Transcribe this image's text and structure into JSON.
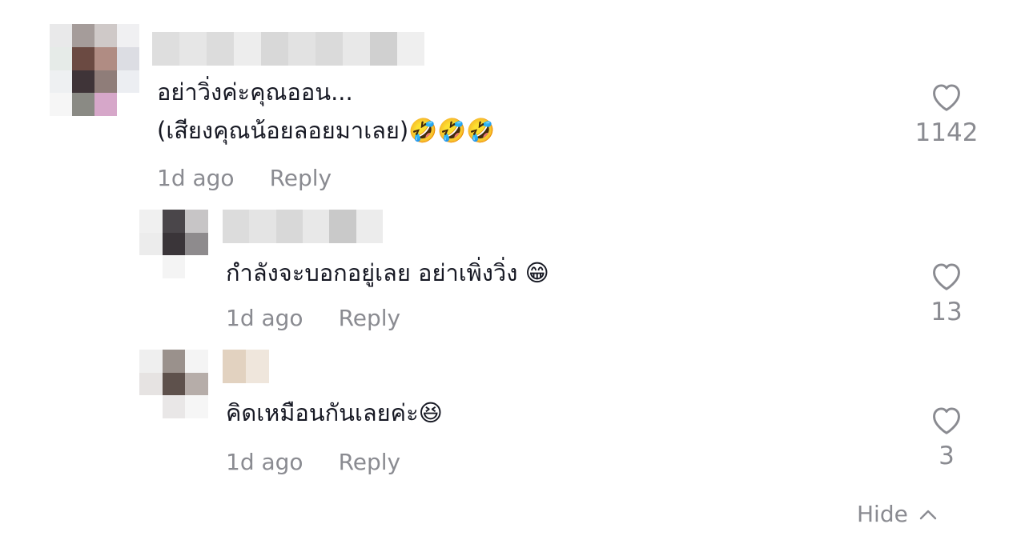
{
  "comments": [
    {
      "text_line1": "อย่าวิ่งค่ะคุณออน...",
      "text_line2": "(เสียงคุณน้อยลอยมาเลย)🤣🤣🤣",
      "time": "1d ago",
      "reply": "Reply",
      "likes": "1142",
      "icon": "heart-outline-icon"
    },
    {
      "text_line1": "กำลังจะบอกอยู่เลย อย่าเพิ่งวิ่ง 😁",
      "time": "1d ago",
      "reply": "Reply",
      "likes": "13",
      "icon": "heart-outline-icon"
    },
    {
      "text_line1": "คิดเหมือนกันเลยค่ะ😆",
      "time": "1d ago",
      "reply": "Reply",
      "likes": "3",
      "icon": "heart-outline-icon"
    }
  ],
  "hide": {
    "label": "Hide",
    "icon": "chevron-up-icon"
  },
  "colors": {
    "text": "#161823",
    "muted": "#8a8b91"
  }
}
